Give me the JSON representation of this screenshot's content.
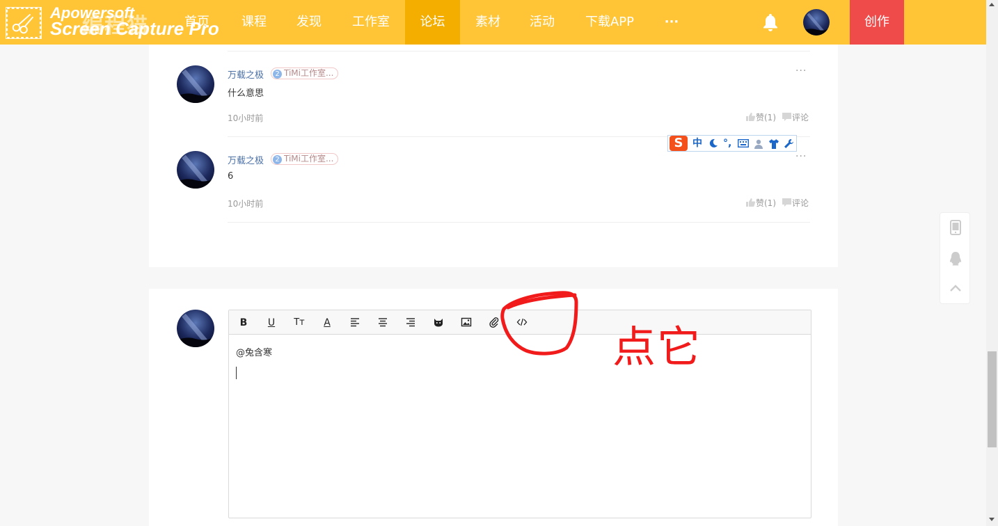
{
  "watermark": {
    "line1": "Apowersoft",
    "line2": "Screen Capture Pro",
    "site_name": "编程猫"
  },
  "nav": {
    "items": [
      {
        "label": "首页"
      },
      {
        "label": "课程"
      },
      {
        "label": "发现"
      },
      {
        "label": "工作室"
      },
      {
        "label": "论坛"
      },
      {
        "label": "素材"
      },
      {
        "label": "活动"
      },
      {
        "label": "下载APP"
      },
      {
        "label": "···"
      }
    ],
    "active_index": 4,
    "create_label": "创作"
  },
  "comments": [
    {
      "user": "万载之极",
      "badge_level": "2",
      "badge_text": "TiMi工作室...",
      "text": "什么意思",
      "time": "10小时前",
      "like_label": "赞(1)",
      "reply_label": "评论",
      "more": "···"
    },
    {
      "user": "万载之极",
      "badge_level": "2",
      "badge_text": "TiMi工作室...",
      "text": "6",
      "time": "10小时前",
      "like_label": "赞(1)",
      "reply_label": "评论",
      "more": "···"
    }
  ],
  "editor": {
    "toolbar": {
      "bold": "B",
      "underline": "U",
      "font_size": "Tт",
      "font_color": "A"
    },
    "content_mention": "@兔含寒"
  },
  "annotation": {
    "text": "点它"
  },
  "ime": {
    "logo": "S",
    "mode": "中",
    "punct": "°,"
  },
  "colors": {
    "nav_bg": "#ffc536",
    "nav_active": "#f3ae00",
    "create_bg": "#f04b4b",
    "annotation": "#f21b1b"
  }
}
